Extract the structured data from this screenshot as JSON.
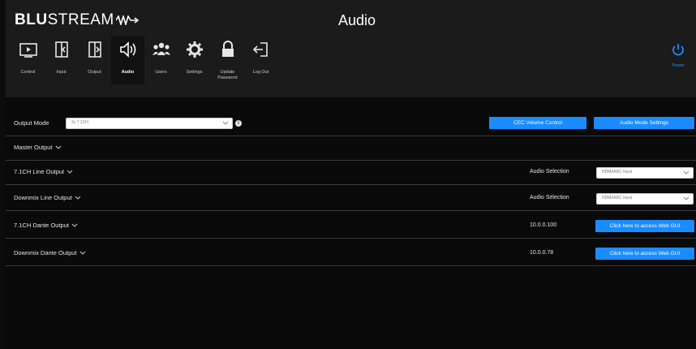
{
  "app": {
    "brand_bold": "BLU",
    "brand_light": "STREAM",
    "page_title": "Audio"
  },
  "nav": [
    {
      "label": "Control",
      "icon": "monitor-play-icon"
    },
    {
      "label": "Input",
      "icon": "input-icon"
    },
    {
      "label": "Output",
      "icon": "output-icon"
    },
    {
      "label": "Audio",
      "icon": "speaker-icon",
      "active": true
    },
    {
      "label": "Users",
      "icon": "users-icon"
    },
    {
      "label": "Settings",
      "icon": "gear-icon"
    },
    {
      "label": "Update Password",
      "icon": "lock-icon"
    },
    {
      "label": "Log Out",
      "icon": "logout-icon"
    }
  ],
  "power": {
    "label": "Power",
    "icon": "power-icon"
  },
  "output_mode": {
    "label": "Output Mode",
    "value": "2x 7.1CH",
    "info_icon": "info-icon"
  },
  "buttons": {
    "cec": "CEC Volume Control",
    "audio_mode": "Audio Mode Settings",
    "web_gui_1": "Click here to access Web GUI",
    "web_gui_2": "Click here to access Web GUI"
  },
  "sections": {
    "master": "Master Output",
    "line71": "7.1CH Line Output",
    "downmix_line": "Downmix Line Output",
    "dante71": "7.1CH Dante Output",
    "downmix_dante": "Downmix Dante Output"
  },
  "audio_selection": {
    "label1": "Audio Selection",
    "value1": "HDMI/ARC Input",
    "label2": "Audio Selection",
    "value2": "HDMI/ARC Input"
  },
  "dante_ips": {
    "ip71": "10.0.0.100",
    "ip_downmix": "10.0.0.78"
  },
  "colors": {
    "accent": "#1a8cff",
    "topbar": "#1b1b1b",
    "background": "#0a0a0a"
  }
}
